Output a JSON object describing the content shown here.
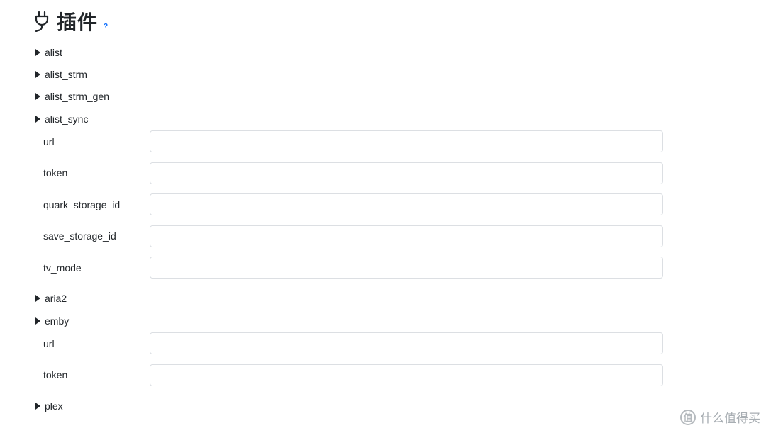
{
  "header": {
    "title": "插件",
    "help": "?"
  },
  "plugins": [
    {
      "name": "alist"
    },
    {
      "name": "alist_strm"
    },
    {
      "name": "alist_strm_gen"
    },
    {
      "name": "alist_sync",
      "fields": [
        {
          "label": "url",
          "value": ""
        },
        {
          "label": "token",
          "value": ""
        },
        {
          "label": "quark_storage_id",
          "value": ""
        },
        {
          "label": "save_storage_id",
          "value": ""
        },
        {
          "label": "tv_mode",
          "value": ""
        }
      ]
    },
    {
      "name": "aria2"
    },
    {
      "name": "emby",
      "fields": [
        {
          "label": "url",
          "value": ""
        },
        {
          "label": "token",
          "value": ""
        }
      ]
    },
    {
      "name": "plex"
    }
  ],
  "watermark": {
    "text": "什么值得买",
    "icon": "值"
  }
}
